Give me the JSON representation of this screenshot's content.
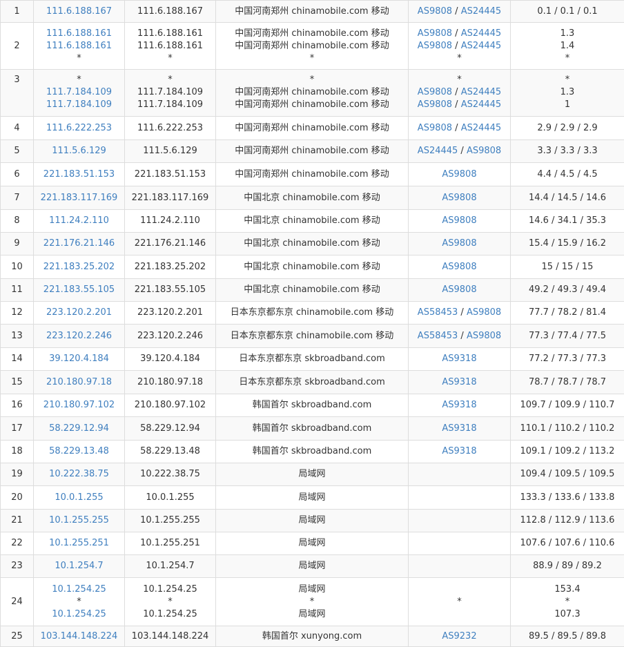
{
  "colors": {
    "link": "#3f7fbf",
    "text": "#333333",
    "border": "#dddddd",
    "stripe": "#f9f9f9"
  },
  "hops": [
    {
      "no": "1",
      "entries": [
        {
          "ip": "111.6.188.167",
          "host": "111.6.188.167",
          "loc": "中国河南郑州 chinamobile.com 移动",
          "as": [
            "AS9808",
            "AS24445"
          ],
          "rtt": "0.1 / 0.1 / 0.1"
        }
      ]
    },
    {
      "no": "2",
      "entries": [
        {
          "ip": "111.6.188.161",
          "host": "111.6.188.161",
          "loc": "中国河南郑州 chinamobile.com 移动",
          "as": [
            "AS9808",
            "AS24445"
          ],
          "rtt": "1.3"
        },
        {
          "ip": "111.6.188.161",
          "host": "111.6.188.161",
          "loc": "中国河南郑州 chinamobile.com 移动",
          "as": [
            "AS9808",
            "AS24445"
          ],
          "rtt": "1.4"
        },
        {
          "ip": "*",
          "host": "*",
          "loc": "*",
          "as": [],
          "as_text": "*",
          "rtt": "*"
        }
      ]
    },
    {
      "no": "3",
      "entries": [
        {
          "ip": "*",
          "host": "*",
          "loc": "*",
          "as": [],
          "as_text": "*",
          "rtt": "*"
        },
        {
          "ip": "111.7.184.109",
          "host": "111.7.184.109",
          "loc": "中国河南郑州 chinamobile.com 移动",
          "as": [
            "AS9808",
            "AS24445"
          ],
          "rtt": "1.3"
        },
        {
          "ip": "111.7.184.109",
          "host": "111.7.184.109",
          "loc": "中国河南郑州 chinamobile.com 移动",
          "as": [
            "AS9808",
            "AS24445"
          ],
          "rtt": "1"
        }
      ]
    },
    {
      "no": "4",
      "entries": [
        {
          "ip": "111.6.222.253",
          "host": "111.6.222.253",
          "loc": "中国河南郑州 chinamobile.com 移动",
          "as": [
            "AS9808",
            "AS24445"
          ],
          "rtt": "2.9 / 2.9 / 2.9"
        }
      ]
    },
    {
      "no": "5",
      "entries": [
        {
          "ip": "111.5.6.129",
          "host": "111.5.6.129",
          "loc": "中国河南郑州 chinamobile.com 移动",
          "as": [
            "AS24445",
            "AS9808"
          ],
          "rtt": "3.3 / 3.3 / 3.3"
        }
      ]
    },
    {
      "no": "6",
      "entries": [
        {
          "ip": "221.183.51.153",
          "host": "221.183.51.153",
          "loc": "中国河南郑州 chinamobile.com 移动",
          "as": [
            "AS9808"
          ],
          "rtt": "4.4 / 4.5 / 4.5"
        }
      ]
    },
    {
      "no": "7",
      "entries": [
        {
          "ip": "221.183.117.169",
          "host": "221.183.117.169",
          "loc": "中国北京 chinamobile.com 移动",
          "as": [
            "AS9808"
          ],
          "rtt": "14.4 / 14.5 / 14.6"
        }
      ]
    },
    {
      "no": "8",
      "entries": [
        {
          "ip": "111.24.2.110",
          "host": "111.24.2.110",
          "loc": "中国北京 chinamobile.com 移动",
          "as": [
            "AS9808"
          ],
          "rtt": "14.6 / 34.1 / 35.3"
        }
      ]
    },
    {
      "no": "9",
      "entries": [
        {
          "ip": "221.176.21.146",
          "host": "221.176.21.146",
          "loc": "中国北京 chinamobile.com 移动",
          "as": [
            "AS9808"
          ],
          "rtt": "15.4 / 15.9 / 16.2"
        }
      ]
    },
    {
      "no": "10",
      "entries": [
        {
          "ip": "221.183.25.202",
          "host": "221.183.25.202",
          "loc": "中国北京 chinamobile.com 移动",
          "as": [
            "AS9808"
          ],
          "rtt": "15 / 15 / 15"
        }
      ]
    },
    {
      "no": "11",
      "entries": [
        {
          "ip": "221.183.55.105",
          "host": "221.183.55.105",
          "loc": "中国北京 chinamobile.com 移动",
          "as": [
            "AS9808"
          ],
          "rtt": "49.2 / 49.3 / 49.4"
        }
      ]
    },
    {
      "no": "12",
      "entries": [
        {
          "ip": "223.120.2.201",
          "host": "223.120.2.201",
          "loc": "日本东京都东京 chinamobile.com 移动",
          "as": [
            "AS58453",
            "AS9808"
          ],
          "rtt": "77.7 / 78.2 / 81.4"
        }
      ]
    },
    {
      "no": "13",
      "entries": [
        {
          "ip": "223.120.2.246",
          "host": "223.120.2.246",
          "loc": "日本东京都东京 chinamobile.com 移动",
          "as": [
            "AS58453",
            "AS9808"
          ],
          "rtt": "77.3 / 77.4 / 77.5"
        }
      ]
    },
    {
      "no": "14",
      "entries": [
        {
          "ip": "39.120.4.184",
          "host": "39.120.4.184",
          "loc": "日本东京都东京 skbroadband.com",
          "as": [
            "AS9318"
          ],
          "rtt": "77.2 / 77.3 / 77.3"
        }
      ]
    },
    {
      "no": "15",
      "entries": [
        {
          "ip": "210.180.97.18",
          "host": "210.180.97.18",
          "loc": "日本东京都东京 skbroadband.com",
          "as": [
            "AS9318"
          ],
          "rtt": "78.7 / 78.7 / 78.7"
        }
      ]
    },
    {
      "no": "16",
      "entries": [
        {
          "ip": "210.180.97.102",
          "host": "210.180.97.102",
          "loc": "韩国首尔 skbroadband.com",
          "as": [
            "AS9318"
          ],
          "rtt": "109.7 / 109.9 / 110.7"
        }
      ]
    },
    {
      "no": "17",
      "entries": [
        {
          "ip": "58.229.12.94",
          "host": "58.229.12.94",
          "loc": "韩国首尔 skbroadband.com",
          "as": [
            "AS9318"
          ],
          "rtt": "110.1 / 110.2 / 110.2"
        }
      ]
    },
    {
      "no": "18",
      "entries": [
        {
          "ip": "58.229.13.48",
          "host": "58.229.13.48",
          "loc": "韩国首尔 skbroadband.com",
          "as": [
            "AS9318"
          ],
          "rtt": "109.1 / 109.2 / 113.2"
        }
      ]
    },
    {
      "no": "19",
      "entries": [
        {
          "ip": "10.222.38.75",
          "host": "10.222.38.75",
          "loc": "局域网",
          "as": [],
          "rtt": "109.4 / 109.5 / 109.5"
        }
      ]
    },
    {
      "no": "20",
      "entries": [
        {
          "ip": "10.0.1.255",
          "host": "10.0.1.255",
          "loc": "局域网",
          "as": [],
          "rtt": "133.3 / 133.6 / 133.8"
        }
      ]
    },
    {
      "no": "21",
      "entries": [
        {
          "ip": "10.1.255.255",
          "host": "10.1.255.255",
          "loc": "局域网",
          "as": [],
          "rtt": "112.8 / 112.9 / 113.6"
        }
      ]
    },
    {
      "no": "22",
      "entries": [
        {
          "ip": "10.1.255.251",
          "host": "10.1.255.251",
          "loc": "局域网",
          "as": [],
          "rtt": "107.6 / 107.6 / 110.6"
        }
      ]
    },
    {
      "no": "23",
      "entries": [
        {
          "ip": "10.1.254.7",
          "host": "10.1.254.7",
          "loc": "局域网",
          "as": [],
          "rtt": "88.9 / 89 / 89.2"
        }
      ]
    },
    {
      "no": "24",
      "entries": [
        {
          "ip": "10.1.254.25",
          "host": "10.1.254.25",
          "loc": "局域网",
          "as": [],
          "rtt": "153.4"
        },
        {
          "ip": "*",
          "host": "*",
          "loc": "*",
          "as": [],
          "as_text": "*",
          "rtt": "*"
        },
        {
          "ip": "10.1.254.25",
          "host": "10.1.254.25",
          "loc": "局域网",
          "as": [],
          "rtt": "107.3"
        }
      ]
    },
    {
      "no": "25",
      "entries": [
        {
          "ip": "103.144.148.224",
          "host": "103.144.148.224",
          "loc": "韩国首尔 xunyong.com",
          "as": [
            "AS9232"
          ],
          "rtt": "89.5 / 89.5 / 89.8"
        }
      ]
    }
  ]
}
